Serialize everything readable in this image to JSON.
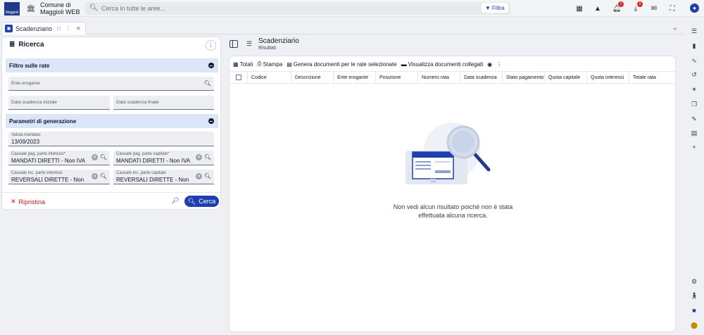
{
  "app": {
    "logo_text": "Maggioli",
    "org_line1": "Comune di",
    "org_line2": "Maggioli WEB"
  },
  "search": {
    "placeholder": "Cerca in tutte le aree...",
    "filter_label": "Filtra"
  },
  "notifications": {
    "bell_count": "1",
    "download_count": "2"
  },
  "tabs": [
    {
      "label": "Scadenziario"
    }
  ],
  "left_panel": {
    "title": "Ricerca",
    "section_rate": {
      "title": "Filtro sulle rate",
      "ente_erogante_placeholder": "Ente erogante",
      "data_iniziale_placeholder": "Data scadenza iniziale",
      "data_finale_placeholder": "Data scadenza finale"
    },
    "section_param": {
      "title": "Parametri di generazione",
      "valuta_label": "Valuta mandato",
      "valuta_value": "13/09/2023",
      "causale_pag_interessi_label": "Causale pag. parte interessi",
      "causale_pag_interessi_value": "MANDATI DIRETTI - Non IVA...",
      "causale_pag_capitale_label": "Causale pag. parte capitale",
      "causale_pag_capitale_value": "MANDATI DIRETTI - Non IVA...",
      "causale_inc_interessi_label": "Causale inc. parte interessi",
      "causale_inc_interessi_value": "REVERSALI DIRETTE - Non I...",
      "causale_inc_capitale_label": "Causale inc. parte capitale",
      "causale_inc_capitale_value": "REVERSALI DIRETTE - Non I..."
    },
    "reset_label": "Ripristina",
    "search_label": "Cerca"
  },
  "right_panel": {
    "title": "Scadenziario",
    "subtitle": "Risultati",
    "toolbar": {
      "totali": "Totali",
      "stampa": "Stampa",
      "genera": "Genera documenti per le rate selezionate",
      "visualizza": "Visualizza documenti collegati"
    },
    "columns": [
      "Codice",
      "Descrizione",
      "Ente erogante",
      "Posizione",
      "Numero rata",
      "Data scadenza",
      "Stato pagamento",
      "Quota capitale",
      "Quota interessi",
      "Totale rata"
    ],
    "empty_line1": "Non vedi alcun risultato poiché non è stata",
    "empty_line2": "effettuata alcuna ricerca."
  },
  "colors": {
    "accent": "#1e40af",
    "section_bg": "#dbe7f8",
    "danger": "#b91c1c"
  }
}
